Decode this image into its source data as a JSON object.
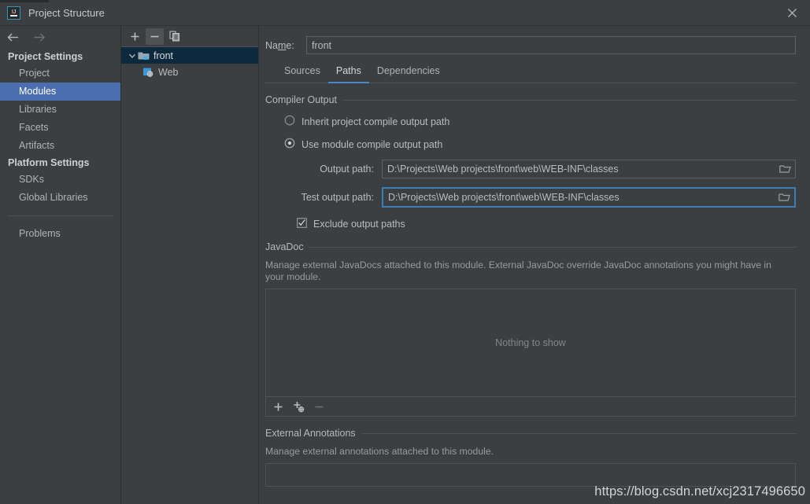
{
  "window": {
    "title": "Project Structure",
    "logo_icon": "intellij-idea-logo-icon",
    "close_icon": "close-icon"
  },
  "sidebar": {
    "back_icon": "arrow-left-icon",
    "forward_icon": "arrow-right-icon",
    "groups": [
      {
        "label": "Project Settings",
        "items": [
          {
            "label": "Project",
            "selected": false
          },
          {
            "label": "Modules",
            "selected": true
          },
          {
            "label": "Libraries",
            "selected": false
          },
          {
            "label": "Facets",
            "selected": false
          },
          {
            "label": "Artifacts",
            "selected": false
          }
        ]
      },
      {
        "label": "Platform Settings",
        "items": [
          {
            "label": "SDKs",
            "selected": false
          },
          {
            "label": "Global Libraries",
            "selected": false
          }
        ]
      }
    ],
    "problems": {
      "label": "Problems",
      "selected": false
    }
  },
  "tree": {
    "toolbar": {
      "add_label": "+",
      "add_icon": "plus-icon",
      "remove_label": "−",
      "remove_icon": "minus-icon",
      "copy_icon": "copy-icon"
    },
    "nodes": [
      {
        "label": "front",
        "icon": "module-folder-icon",
        "selected": true,
        "expanded": true,
        "level": 0
      },
      {
        "label": "Web",
        "icon": "web-facet-icon",
        "selected": false,
        "level": 1
      }
    ]
  },
  "main": {
    "name": {
      "label_before": "Na",
      "label_mnemonic": "m",
      "label_after": "e:",
      "value": "front"
    },
    "tabs": [
      {
        "label": "Sources",
        "active": false
      },
      {
        "label": "Paths",
        "active": true
      },
      {
        "label": "Dependencies",
        "active": false
      }
    ],
    "compiler_output": {
      "title": "Compiler Output",
      "radios": [
        {
          "label": "Inherit project compile output path",
          "selected": false
        },
        {
          "label": "Use module compile output path",
          "selected": true
        }
      ],
      "output_path": {
        "label": "Output path:",
        "value": "D:\\Projects\\Web projects\\front\\web\\WEB-INF\\classes",
        "browse_icon": "folder-browse-icon",
        "focused": false
      },
      "test_output_path": {
        "label": "Test output path:",
        "value": "D:\\Projects\\Web projects\\front\\web\\WEB-INF\\classes",
        "browse_icon": "folder-browse-icon",
        "focused": true
      },
      "exclude_checkbox": {
        "label": "Exclude output paths",
        "checked": true
      }
    },
    "javadoc": {
      "title": "JavaDoc",
      "description": "Manage external JavaDocs attached to this module. External JavaDoc override JavaDoc annotations you might have in your module.",
      "empty_text": "Nothing to show",
      "toolbar": {
        "add_icon": "plus-icon",
        "add_url_icon": "plus-globe-icon",
        "remove_icon": "minus-icon"
      }
    },
    "external_annotations": {
      "title": "External Annotations",
      "description": "Manage external annotations attached to this module."
    }
  },
  "watermark": "https://blog.csdn.net/xcj2317496650",
  "colors": {
    "background": "#3c3f41",
    "selection_blue": "#4b6eaf",
    "tree_selection": "#0d293e",
    "accent_blue": "#4a88c7",
    "focus_border": "#3d7fb5",
    "text": "#bbbbbb",
    "muted_text": "#9a9a9a"
  }
}
